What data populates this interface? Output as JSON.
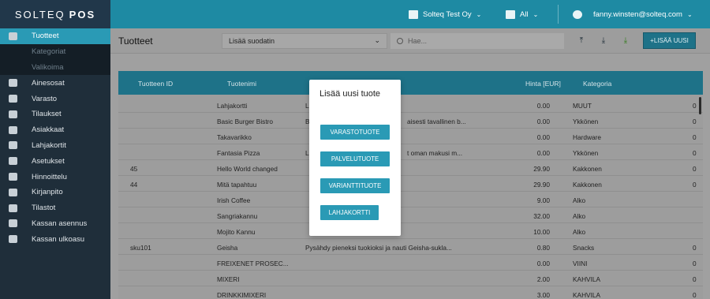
{
  "brand": {
    "name": "SOLTEQ",
    "suffix": "POS"
  },
  "topbar": {
    "company": "Solteq Test Oy",
    "store": "All",
    "user": "fanny.winsten@solteq.com"
  },
  "sidebar": {
    "items": [
      {
        "label": "Tuotteet",
        "icon": "utensils-icon",
        "state": "active"
      },
      {
        "label": "Kategoriat",
        "icon": "",
        "state": "sub"
      },
      {
        "label": "Valikoima",
        "icon": "",
        "state": "sub"
      },
      {
        "label": "Ainesosat",
        "icon": "tools-icon",
        "state": ""
      },
      {
        "label": "Varasto",
        "icon": "warehouse-icon",
        "state": ""
      },
      {
        "label": "Tilaukset",
        "icon": "cart-icon",
        "state": ""
      },
      {
        "label": "Asiakkaat",
        "icon": "users-icon",
        "state": ""
      },
      {
        "label": "Lahjakortit",
        "icon": "gift-icon",
        "state": ""
      },
      {
        "label": "Asetukset",
        "icon": "wrench-icon",
        "state": ""
      },
      {
        "label": "Hinnoittelu",
        "icon": "euro-icon",
        "state": ""
      },
      {
        "label": "Kirjanpito",
        "icon": "bank-icon",
        "state": ""
      },
      {
        "label": "Tilastot",
        "icon": "bar-chart-icon",
        "state": ""
      },
      {
        "label": "Kassan asennus",
        "icon": "download-icon",
        "state": ""
      },
      {
        "label": "Kassan ulkoasu",
        "icon": "grid-icon",
        "state": ""
      }
    ]
  },
  "toolbar": {
    "title": "Tuotteet",
    "filter_label": "Lisää suodatin",
    "search_placeholder": "Hae...",
    "add_label": "+LISÄÄ UUSI"
  },
  "table": {
    "columns": [
      "Tuotteen ID",
      "Tuotenimi",
      "Hinta [EUR]",
      "Kategoria"
    ],
    "rows": [
      {
        "id": "",
        "name": "Lahjakortti",
        "desc": "L",
        "price": "0.00",
        "category": "MUUT",
        "extra": "0"
      },
      {
        "id": "",
        "name": "Basic Burger Bistro",
        "desc": "B",
        "desc2": "aisesti tavallinen b...",
        "price": "0.00",
        "category": "Ykkönen",
        "extra": "0"
      },
      {
        "id": "",
        "name": "Takavarikko",
        "desc": "",
        "price": "0.00",
        "category": "Hardware",
        "extra": "0"
      },
      {
        "id": "",
        "name": "Fantasia Pizza",
        "desc": "L",
        "desc2": "t oman makusi m...",
        "price": "0.00",
        "category": "Ykkönen",
        "extra": "0"
      },
      {
        "id": "45",
        "name": "Hello World changed",
        "desc": "",
        "price": "29.90",
        "category": "Kakkonen",
        "extra": "0"
      },
      {
        "id": "44",
        "name": "Mitä tapahtuu",
        "desc": "",
        "price": "29.90",
        "category": "Kakkonen",
        "extra": "0"
      },
      {
        "id": "",
        "name": "Irish Coffee",
        "desc": "",
        "price": "9.00",
        "category": "Alko",
        "extra": ""
      },
      {
        "id": "",
        "name": "Sangriakannu",
        "desc": "",
        "price": "32.00",
        "category": "Alko",
        "extra": ""
      },
      {
        "id": "",
        "name": "Mojito Kannu",
        "desc": "",
        "price": "10.00",
        "category": "Alko",
        "extra": ""
      },
      {
        "id": "sku101",
        "name": "Geisha",
        "desc": "Pysähdy pieneksi tuokioksi ja nauti Geisha-sukla...",
        "price": "0.80",
        "category": "Snacks",
        "extra": "0"
      },
      {
        "id": "",
        "name": "FREIXENET PROSEC...",
        "desc": "",
        "price": "0.00",
        "category": "VIINI",
        "extra": "0"
      },
      {
        "id": "",
        "name": "MIXERI",
        "desc": "",
        "price": "2.00",
        "category": "KAHVILA",
        "extra": "0"
      },
      {
        "id": "",
        "name": "DRINKKIMIXERI",
        "desc": "",
        "price": "3.00",
        "category": "KAHVILA",
        "extra": "0"
      }
    ]
  },
  "modal": {
    "title": "Lisää uusi tuote",
    "buttons": [
      "VARASTOTUOTE",
      "PALVELUTUOTE",
      "VARIANTTITUOTE",
      "LAHJAKORTTI"
    ]
  }
}
